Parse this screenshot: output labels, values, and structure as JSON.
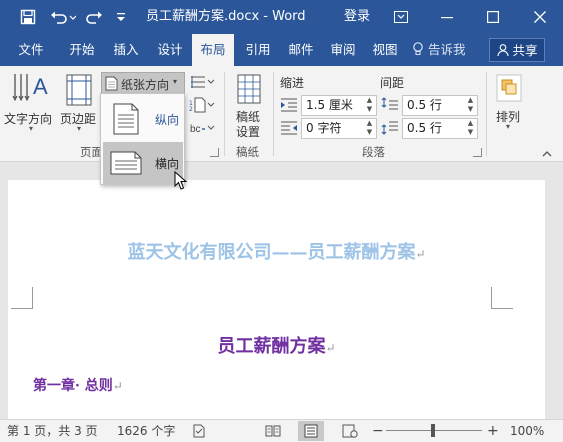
{
  "titlebar": {
    "save_icon": "save-icon",
    "undo_icon": "undo-icon",
    "redo_icon": "redo-icon",
    "customize_icon": "customize-quick-access-icon",
    "title": "员工薪酬方案.docx - Word",
    "login": "登录",
    "ribbon_display_icon": "ribbon-display-options-icon",
    "minimize_icon": "minimize-icon",
    "maximize_icon": "maximize-icon",
    "close_icon": "close-icon"
  },
  "tabs": {
    "items": [
      {
        "label": "文件"
      },
      {
        "label": "开始"
      },
      {
        "label": "插入"
      },
      {
        "label": "设计"
      },
      {
        "label": "布局"
      },
      {
        "label": "引用"
      },
      {
        "label": "邮件"
      },
      {
        "label": "审阅"
      },
      {
        "label": "视图"
      }
    ],
    "active": "布局",
    "tell_me": "告诉我",
    "share": "共享"
  },
  "ribbon": {
    "text_direction": "文字方向",
    "margins": "页边距",
    "orientation": "纸张方向",
    "page_group_label": "页面",
    "manuscript": {
      "line1": "稿纸",
      "line2": "设置",
      "group": "稿纸"
    },
    "indent": {
      "heading": "缩进",
      "left": "1.5 厘米",
      "right": "0 字符"
    },
    "spacing": {
      "heading": "间距",
      "before": "0.5 行",
      "after": "0.5 行"
    },
    "paragraph_group": "段落",
    "arrange": "排列"
  },
  "orientation_dropdown": {
    "portrait": "纵向",
    "landscape": "横向",
    "selected": "横向"
  },
  "document": {
    "header": "蓝天文化有限公司——员工薪酬方案",
    "title": "员工薪酬方案",
    "chapter": "第一章· 总则",
    "paragraph_mark": "↵"
  },
  "statusbar": {
    "page": "第 1 页，共 3 页",
    "words": "1626 个字",
    "zoom": "100%"
  },
  "colors": {
    "accent": "#2b579a",
    "header_text": "#9dc3e6",
    "doc_title": "#7030a0"
  }
}
